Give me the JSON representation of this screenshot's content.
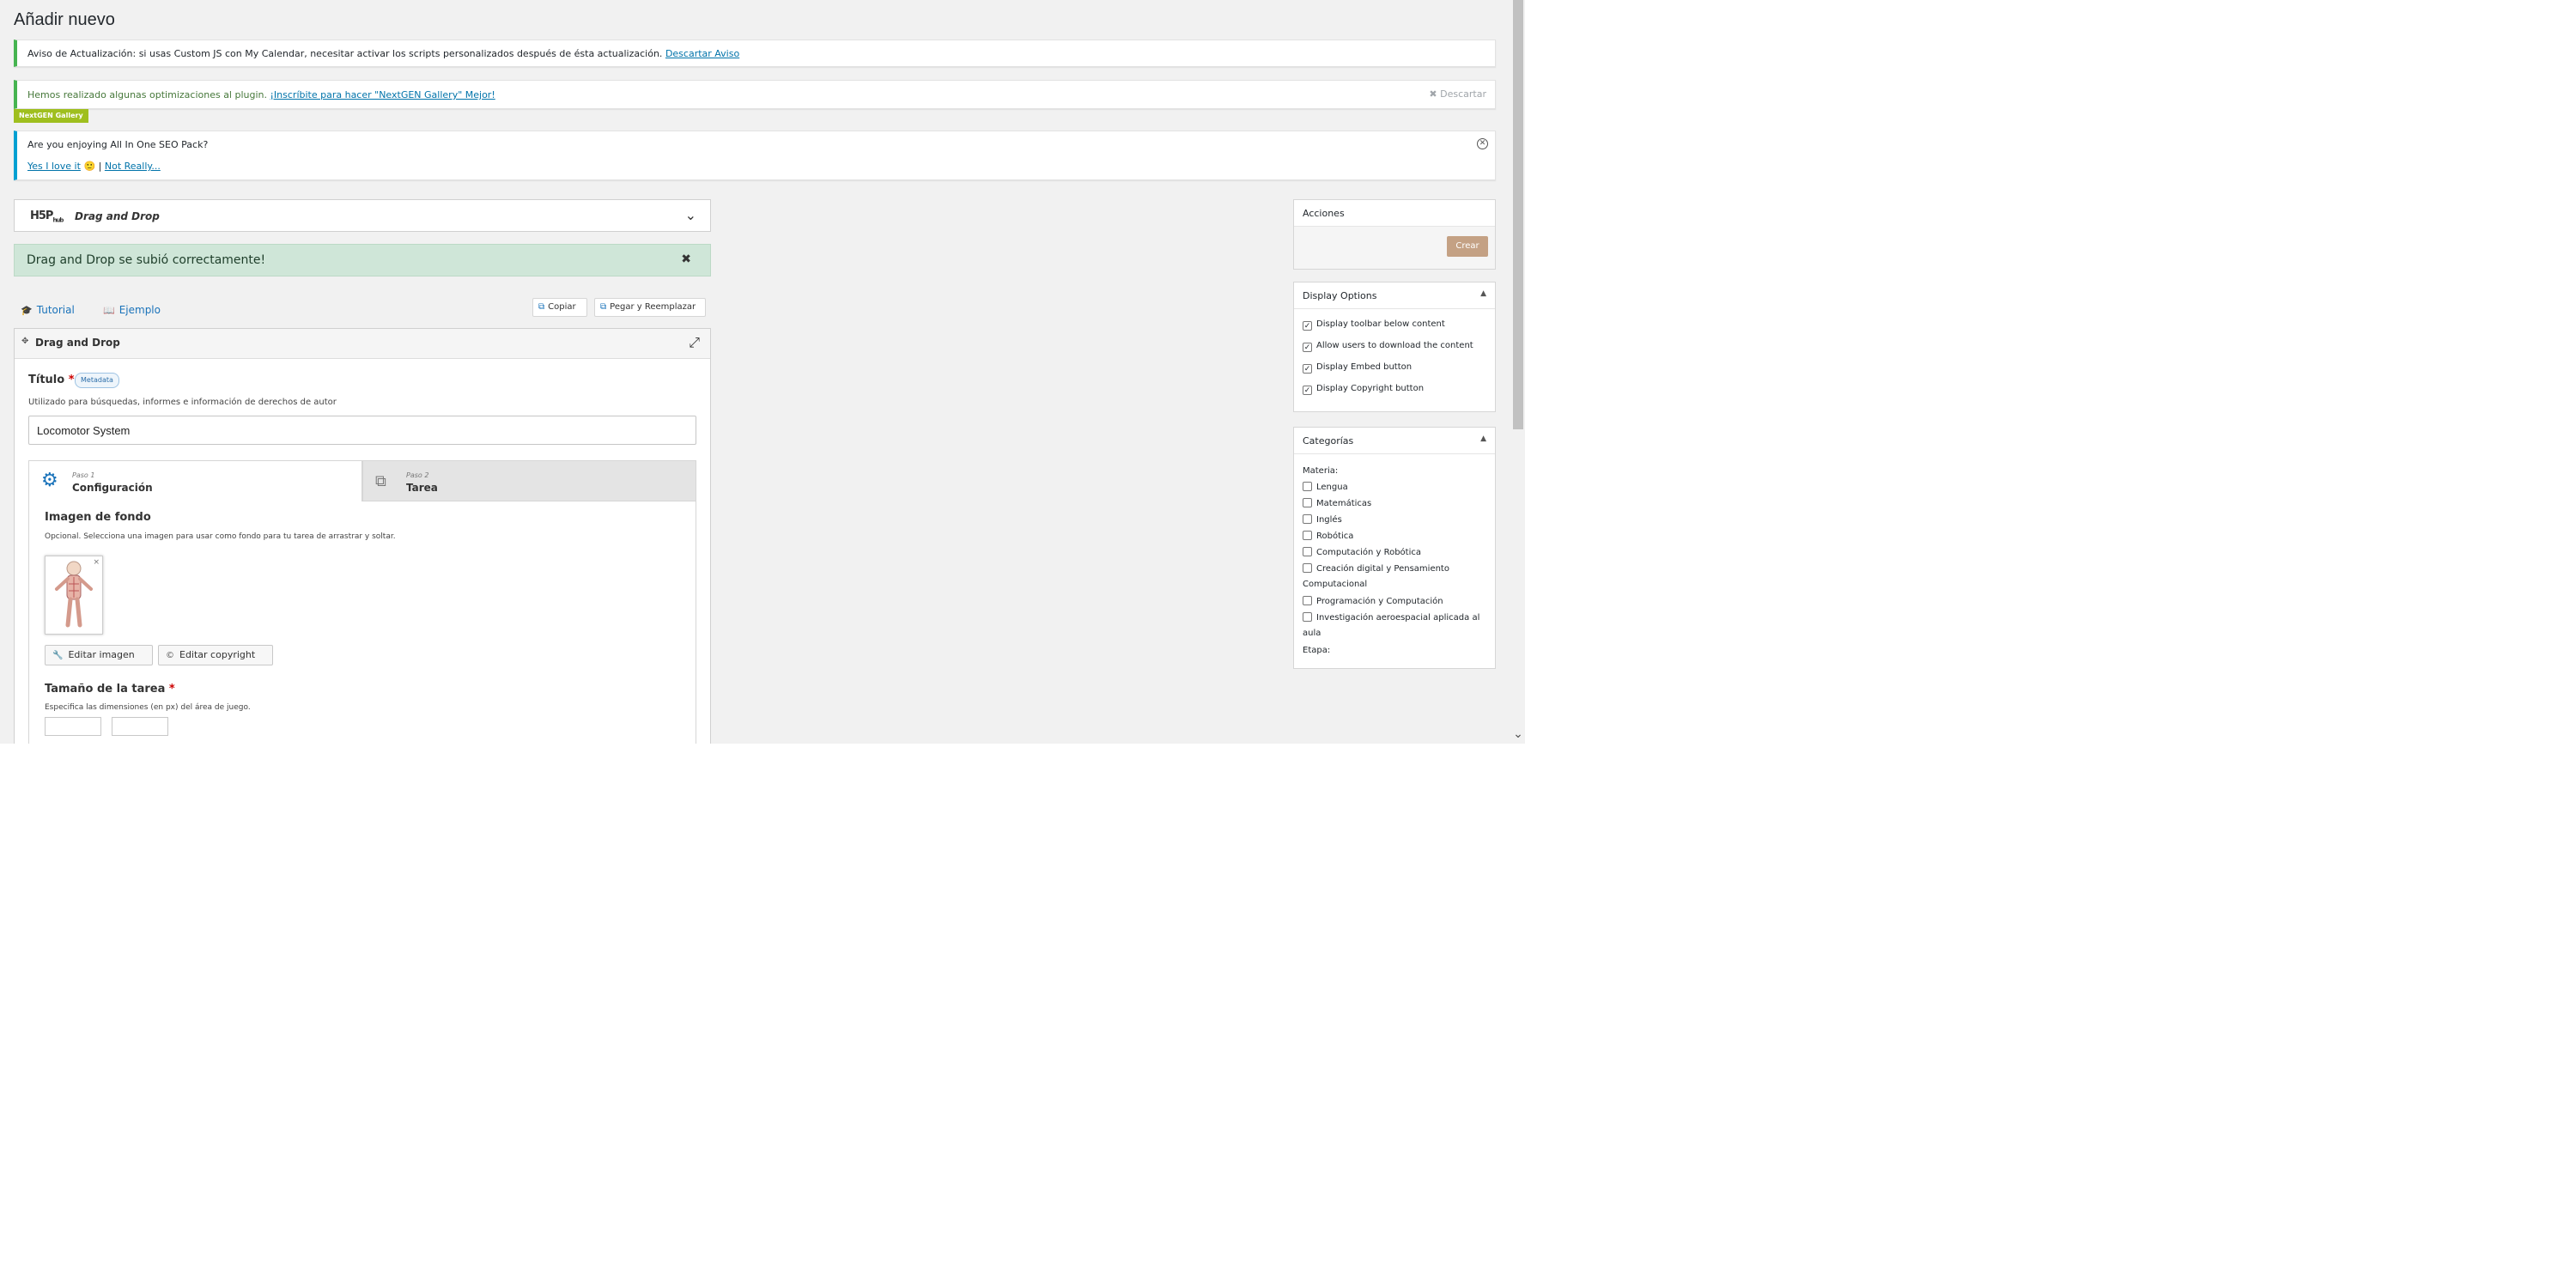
{
  "page": {
    "title": "Añadir nuevo"
  },
  "notices": {
    "update": {
      "text": "Aviso de Actualización: si usas Custom JS con My Calendar, necesitar activar los scripts personalizados después de ésta actualización.",
      "link": "Descartar Aviso"
    },
    "ngg": {
      "text": "Hemos realizado algunas optimizaciones al plugin.",
      "link": "¡Inscríbite para hacer \"NextGEN Gallery\" Mejor!",
      "dismiss": "Descartar",
      "badge": "NextGEN Gallery"
    },
    "aioseo": {
      "question": "Are you enjoying All In One SEO Pack?",
      "yes": "Yes I love it",
      "emoji": "🙂",
      "sep": "|",
      "no": "Not Really..."
    }
  },
  "h5p": {
    "logo": "H5P",
    "logo_suffix": "hub",
    "library": "Drag and Drop",
    "success": "Drag and Drop se subió correctamente!",
    "tutorial": "Tutorial",
    "example": "Ejemplo",
    "copy": "Copiar",
    "paste": "Pegar y Reemplazar",
    "editor_title": "Drag and Drop",
    "field_title": {
      "label": "Título",
      "required": "*",
      "metadata": "Metadata",
      "desc": "Utilizado para búsquedas, informes e información de derechos de autor",
      "value": "Locomotor System"
    },
    "tabs": [
      {
        "step": "Paso 1",
        "name": "Configuración"
      },
      {
        "step": "Paso 2",
        "name": "Tarea"
      }
    ],
    "background": {
      "heading": "Imagen de fondo",
      "desc": "Opcional. Selecciona una imagen para usar como fondo para tu tarea de arrastrar y soltar.",
      "remove": "×",
      "edit_image": "Editar imagen",
      "edit_copyright": "Editar copyright"
    },
    "size": {
      "heading": "Tamaño de la tarea",
      "required": "*",
      "desc": "Especifica las dimensiones (en px) del área de juego."
    }
  },
  "sidebar": {
    "actions": {
      "title": "Acciones",
      "create": "Crear"
    },
    "display": {
      "title": "Display Options",
      "options": [
        {
          "label": "Display toolbar below content",
          "checked": true
        },
        {
          "label": "Allow users to download the content",
          "checked": true
        },
        {
          "label": "Display Embed button",
          "checked": true
        },
        {
          "label": "Display Copyright button",
          "checked": true
        }
      ]
    },
    "categories": {
      "title": "Categorías",
      "materia_label": "Materia:",
      "items": [
        "Lengua",
        "Matemáticas",
        "Inglés",
        "Robótica",
        "Computación y Robótica",
        "Creación digital y Pensamiento Computacional",
        "Programación y Computación",
        "Investigación aeroespacial aplicada al aula"
      ],
      "etapa_label": "Etapa:"
    }
  },
  "colors": {
    "notice_success": "#46b450",
    "notice_info": "#00a0d2",
    "success_bg": "#cfe6d8",
    "create_btn": "#c4a184",
    "h5p_blue": "#1a73ba"
  }
}
